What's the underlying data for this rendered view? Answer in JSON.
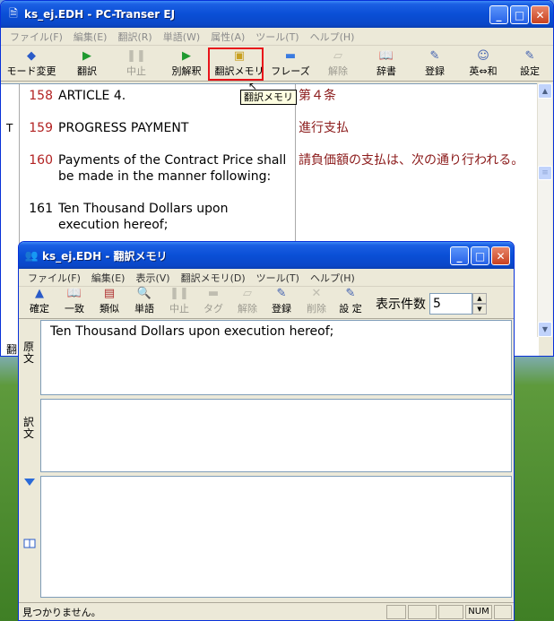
{
  "main_window": {
    "title": "ks_ej.EDH - PC-Transer EJ",
    "menu": [
      "ファイル(F)",
      "編集(E)",
      "翻訳(R)",
      "単語(W)",
      "属性(A)",
      "ツール(T)",
      "ヘルプ(H)"
    ],
    "toolbar": [
      {
        "label": "モード変更",
        "icon": "mode-switch-icon",
        "enabled": true
      },
      {
        "label": "翻訳",
        "icon": "play-icon",
        "enabled": true
      },
      {
        "label": "中止",
        "icon": "pause-icon",
        "enabled": false
      },
      {
        "label": "別解釈",
        "icon": "alternate-icon",
        "enabled": true
      },
      {
        "label": "翻訳メモリ",
        "icon": "memory-icon",
        "enabled": true
      },
      {
        "label": "フレーズ",
        "icon": "phrase-icon",
        "enabled": true
      },
      {
        "label": "解除",
        "icon": "release-icon",
        "enabled": false
      },
      {
        "label": "辞書",
        "icon": "dictionary-icon",
        "enabled": true
      },
      {
        "label": "登録",
        "icon": "register-icon",
        "enabled": true
      },
      {
        "label": "英⇔和",
        "icon": "direction-icon",
        "enabled": true
      },
      {
        "label": "設定",
        "icon": "settings-icon",
        "enabled": true
      }
    ],
    "tooltip": "翻訳メモリ",
    "rows": [
      {
        "mark": "",
        "num": "158",
        "source": "ARTICLE 4.",
        "target": "第４条"
      },
      {
        "mark": "T",
        "num": "159",
        "source": "PROGRESS PAYMENT",
        "target": "進行支払"
      },
      {
        "mark": "",
        "num": "160",
        "source": "Payments of the Contract Price shall be made in the manner following:",
        "target": "請負価額の支払は、次の通り行われる。"
      },
      {
        "mark": "",
        "num": "161",
        "source": "Ten Thousand Dollars upon execution hereof;",
        "target": ""
      }
    ],
    "left_label": "翻"
  },
  "memory_window": {
    "title": "ks_ej.EDH - 翻訳メモリ",
    "menu": [
      "ファイル(F)",
      "編集(E)",
      "表示(V)",
      "翻訳メモリ(D)",
      "ツール(T)",
      "ヘルプ(H)"
    ],
    "toolbar": [
      {
        "label": "確定",
        "icon": "confirm-icon",
        "enabled": true
      },
      {
        "label": "一致",
        "icon": "match-icon",
        "enabled": true
      },
      {
        "label": "類似",
        "icon": "similar-icon",
        "enabled": true
      },
      {
        "label": "単語",
        "icon": "word-search-icon",
        "enabled": true
      },
      {
        "label": "中止",
        "icon": "pause-icon",
        "enabled": false
      },
      {
        "label": "タグ",
        "icon": "tag-icon",
        "enabled": false
      },
      {
        "label": "解除",
        "icon": "release-icon",
        "enabled": false
      },
      {
        "label": "登録",
        "icon": "register-icon",
        "enabled": true
      },
      {
        "label": "削除",
        "icon": "delete-icon",
        "enabled": false
      },
      {
        "label": "設 定",
        "icon": "settings-icon",
        "enabled": true
      }
    ],
    "count_label": "表示件数",
    "count_value": "5",
    "source_label": "原文",
    "source_text": "Ten Thousand Dollars upon execution hereof;",
    "target_label": "訳文",
    "status": "見つかりません。",
    "num_indicator": "NUM"
  }
}
